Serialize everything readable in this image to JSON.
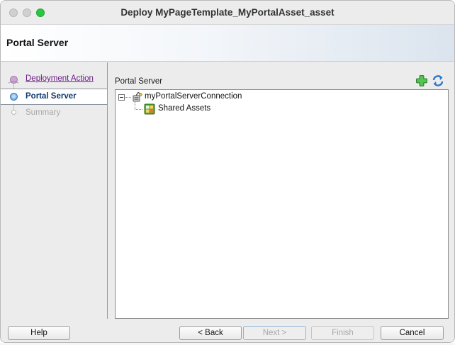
{
  "window": {
    "title": "Deploy MyPageTemplate_MyPortalAsset_asset"
  },
  "header": {
    "title": "Portal Server"
  },
  "nav": {
    "steps": [
      {
        "label": "Deployment Action",
        "state": "done"
      },
      {
        "label": "Portal Server",
        "state": "current"
      },
      {
        "label": "Summary",
        "state": "future"
      }
    ]
  },
  "main": {
    "section_label": "Portal Server",
    "toolbar": {
      "add_icon": "green-plus-icon",
      "refresh_icon": "refresh-icon"
    },
    "tree": {
      "root": {
        "label": "myPortalServerConnection",
        "icon": "server-connection-icon",
        "expanded": true
      },
      "children": [
        {
          "label": "Shared Assets",
          "icon": "shared-assets-icon"
        }
      ]
    }
  },
  "footer": {
    "help": "Help",
    "back": "< Back",
    "next": "Next >",
    "finish": "Finish",
    "cancel": "Cancel"
  },
  "colors": {
    "visited_link": "#6b1f86",
    "current_step": "#0c3a6e",
    "traffic_green": "#2ac840"
  }
}
